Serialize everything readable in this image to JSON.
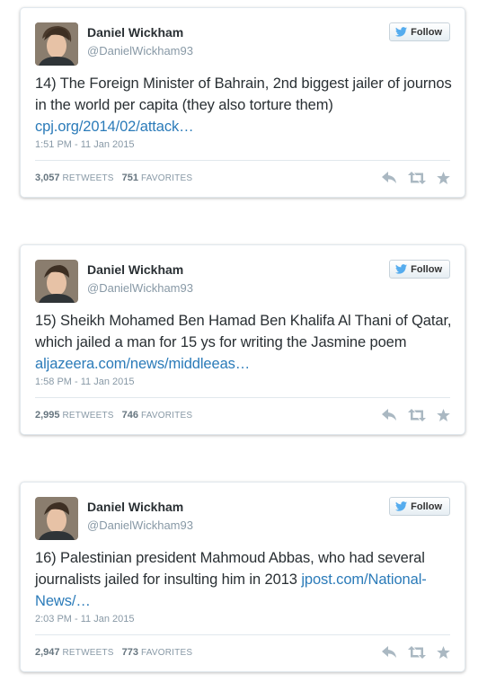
{
  "tweets": [
    {
      "name": "Daniel Wickham",
      "handle": "@DanielWickham93",
      "follow_label": "Follow",
      "text": "14) The Foreign Minister of Bahrain, 2nd biggest jailer of journos in the world per capita (they also torture them) ",
      "link": "cpj.org/2014/02/attack…",
      "time": "1:51 PM - 11 Jan 2015",
      "retweets": "3,057",
      "retweets_label": "RETWEETS",
      "favorites": "751",
      "favorites_label": "FAVORITES"
    },
    {
      "name": "Daniel Wickham",
      "handle": "@DanielWickham93",
      "follow_label": "Follow",
      "text": "15) Sheikh Mohamed Ben Hamad Ben Khalifa Al Thani of Qatar, which jailed a man for 15 ys for writing the Jasmine poem ",
      "link": "aljazeera.com/news/middleeas…",
      "time": "1:58 PM - 11 Jan 2015",
      "retweets": "2,995",
      "retweets_label": "RETWEETS",
      "favorites": "746",
      "favorites_label": "FAVORITES"
    },
    {
      "name": "Daniel Wickham",
      "handle": "@DanielWickham93",
      "follow_label": "Follow",
      "text": "16) Palestinian president Mahmoud Abbas, who had several journalists jailed for insulting him in 2013 ",
      "link": "jpost.com/National-News/…",
      "time": "2:03 PM - 11 Jan 2015",
      "retweets": "2,947",
      "retweets_label": "RETWEETS",
      "favorites": "773",
      "favorites_label": "FAVORITES"
    }
  ],
  "colors": {
    "link": "#2b7bb9",
    "twitter_blue": "#55acee",
    "muted": "#8899a6",
    "border": "#e1e8ed"
  },
  "icons": [
    "bird-icon",
    "reply-icon",
    "retweet-icon",
    "favorite-icon"
  ]
}
